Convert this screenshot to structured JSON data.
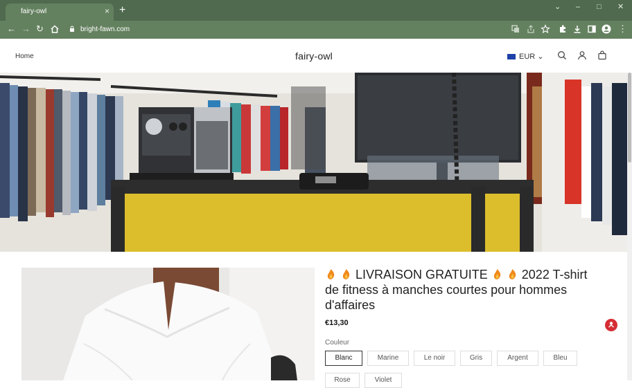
{
  "browser": {
    "tab_title": "fairy-owl",
    "url": "bright-fawn.com",
    "tab_close": "×",
    "new_tab": "+",
    "win_min": "⌄",
    "win_minimize": "–",
    "win_max": "□",
    "win_close": "✕"
  },
  "header": {
    "home": "Home",
    "brand": "fairy-owl",
    "currency": "EUR"
  },
  "product": {
    "title_part1": "LIVRAISON GRATUITE",
    "title_part2": "2022 T-shirt de fitness à manches courtes pour hommes d'affaires",
    "price": "€13,30",
    "color_label": "Couleur",
    "colors": [
      "Blanc",
      "Marine",
      "Le noir",
      "Gris",
      "Argent",
      "Bleu",
      "Rose",
      "Violet"
    ],
    "selected_color": "Blanc"
  },
  "colors": {
    "tab_bar": "#4f6a4f",
    "toolbar": "#64815f",
    "chat": "#d52d35"
  }
}
